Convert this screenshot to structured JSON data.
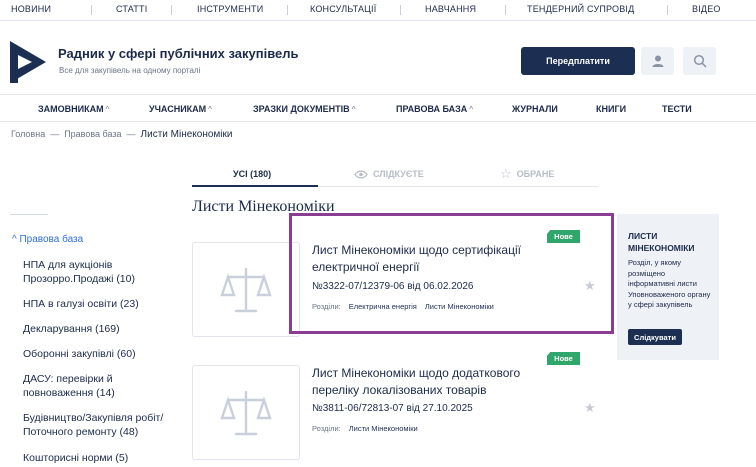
{
  "top_nav": [
    "НОВИНИ",
    "СТАТТІ",
    "ІНСТРУМЕНТИ",
    "КОНСУЛЬТАЦІЇ",
    "НАВЧАННЯ",
    "ТЕНДЕРНИЙ СУПРОВІД",
    "ВІДЕО"
  ],
  "header": {
    "title": "Радник у сфері публічних закупівель",
    "subtitle": "Все для закупівель на одному порталі",
    "subscribe_label": "Передплатити",
    "user_icon": "user-icon",
    "search_icon": "search-icon",
    "accent_color": "#1c2f52"
  },
  "main_nav": [
    {
      "label": "ЗАМОВНИКАМ",
      "caret": "^"
    },
    {
      "label": "УЧАСНИКАМ",
      "caret": "^"
    },
    {
      "label": "ЗРАЗКИ ДОКУМЕНТІВ",
      "caret": "^"
    },
    {
      "label": "ПРАВОВА БАЗА",
      "caret": "^"
    },
    {
      "label": "ЖУРНАЛИ",
      "caret": ""
    },
    {
      "label": "КНИГИ",
      "caret": ""
    },
    {
      "label": "ТЕСТИ",
      "caret": ""
    }
  ],
  "breadcrumb": {
    "items": [
      "Головна",
      "Правова база"
    ],
    "separator": "—",
    "current": "Листи Мінекономіки"
  },
  "tabs": [
    {
      "label": "УСІ (180)",
      "icon": "",
      "active": true
    },
    {
      "label": "СЛІДКУЄТЕ",
      "icon": "eye-icon",
      "active": false
    },
    {
      "label": "ОБРАНЕ",
      "icon": "star-icon",
      "active": false
    }
  ],
  "page_title": "Листи Мінекономіки",
  "sidebar": {
    "root": "^ Правова база",
    "items": [
      "НПА для аукціонів Прозорро.Продажі (10)",
      "НПА в галузі освіти (23)",
      "Декларування (169)",
      "Оборонні закупівлі (60)",
      "ДАСУ: перевірки й повноваження (14)",
      "Будівництво/Закупівля робіт/Поточного ремонту (48)",
      "Кошторисні норми (5)"
    ]
  },
  "documents": [
    {
      "title": "Лист Мінекономіки щодо сертифікації електричної енергії",
      "number": "№3322-07/12379-06 від 06.02.2026",
      "sections_label": "Розділи:",
      "tags": [
        "Електрична енергія",
        "Листи Мінекономіки"
      ],
      "badge": "Нове",
      "icon": "scales-icon"
    },
    {
      "title": "Лист Мінекономіки щодо додаткового переліку локалізованих товарів",
      "number": "№3811-06/72813-07 від 27.10.2025",
      "sections_label": "Розділи:",
      "tags": [
        "Листи Мінекономіки"
      ],
      "badge": "Нове",
      "icon": "scales-icon"
    }
  ],
  "promo": {
    "title": "ЛИСТИ МІНЕКОНОМІКИ",
    "text": "Розділ, у якому розміщено інформативні листи Уповноваженого органу у сфері закупівель",
    "button": "Слідкувати"
  },
  "colors": {
    "badge": "#2fa66a",
    "link": "#2e6fd8",
    "highlight": "#8b3d93"
  }
}
